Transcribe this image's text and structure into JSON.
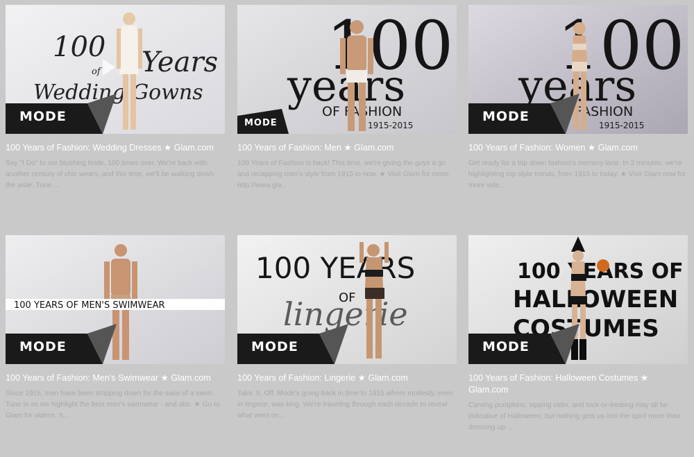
{
  "colors": {
    "page_bg": "#c9c9c9",
    "title_text": "#ffffff",
    "desc_text": "#a9a9a9"
  },
  "videos": [
    {
      "mode_label": "MODE",
      "overlay": {
        "line1": "100",
        "line2": "Years",
        "line3": "of",
        "line4": "Wedding Gowns"
      },
      "title": "100 Years of Fashion: Wedding Dresses ★ Glam.com",
      "description": "Say \"I Do\" to our blushing bride, 100 times over. We're back with another century of chic wears, and this time, we'll be walking down the aisle. Tune ..."
    },
    {
      "mode_label": "MODE",
      "overlay": {
        "line1": "100",
        "line2": "years",
        "line3": "OF FASHION",
        "line4": "1915-2015"
      },
      "title": "100 Years of Fashion: Men ★ Glam.com",
      "description": "100 Years of Fashion is back! This time, we're giving the guys a go and recapping men's style from 1915 to now. ★ Visit Glam for more: http://www.gla..."
    },
    {
      "mode_label": "MODE",
      "overlay": {
        "line1": "100",
        "line2": "years",
        "line3": "OF FASHION",
        "line4": "1915-2015"
      },
      "title": "100 Years of Fashion: Women ★ Glam.com",
      "description": "Get ready for a trip down fashion's memory lane. In 2 minutes, we're highlighting top style trends, from 1915 to today. ★ Visit Glam now for more vide..."
    },
    {
      "mode_label": "MODE",
      "overlay": {
        "line1": "100 YEARS OF MEN'S SWIMWEAR"
      },
      "title": "100 Years of Fashion: Men's Swimwear ★ Glam.com",
      "description": "Since 1915, men have been stripping down for the sake of a swim. Tune in as we highlight the best men's swimwear - and abs. ★ Go to Glam for videos: h..."
    },
    {
      "mode_label": "MODE",
      "overlay": {
        "line1": "100 YEARS",
        "line2": "OF",
        "line3": "lingerie"
      },
      "title": "100 Years of Fashion: Lingerie ★ Glam.com",
      "description": "Take. It. Off. Mode's going back in time to 1915 where modesty, even in lingerie, was king. We're traveling through each decade to reveal what went on..."
    },
    {
      "mode_label": "MODE",
      "overlay": {
        "line1": "100 YEARS OF",
        "line2": "HALLOWEEN",
        "line3": "COSTUMES"
      },
      "title": "100 Years of Fashion: Halloween Costumes ★ Glam.com",
      "description": "Carving pumpkins, sipping cider, and trick-or-treating may all be indicative of Halloween, but nothing gets us into the spirit more than dressing up. ..."
    }
  ]
}
